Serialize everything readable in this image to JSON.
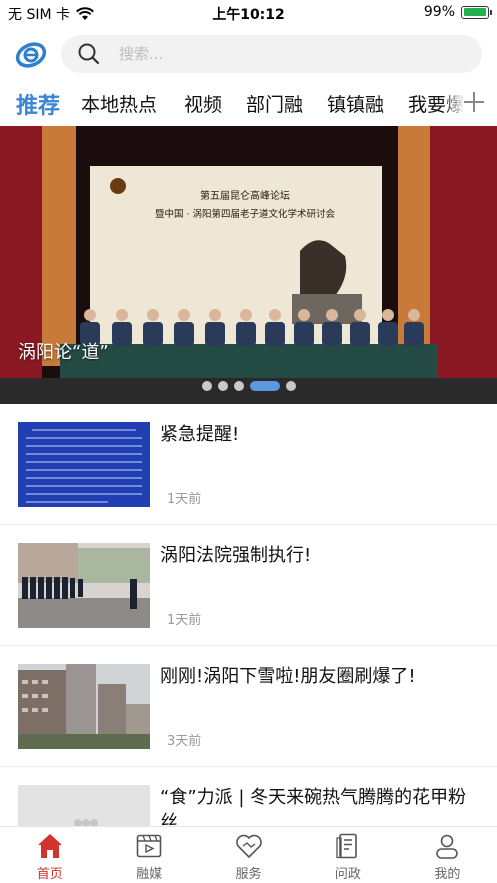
{
  "status_bar": {
    "carrier": "无 SIM 卡",
    "time": "上午10:12",
    "battery": "99%",
    "battery_level": 0.99
  },
  "header": {
    "logo_icon": "app-logo-icon",
    "search_placeholder": "搜索..."
  },
  "tabs": [
    {
      "label": "推荐",
      "active": true
    },
    {
      "label": "本地热点",
      "active": false
    },
    {
      "label": "视频",
      "active": false
    },
    {
      "label": "部门融",
      "active": false
    },
    {
      "label": "镇镇融",
      "active": false
    },
    {
      "label": "我要爆",
      "active": false
    }
  ],
  "banner": {
    "caption": "涡阳论“道”",
    "slide_count": 5,
    "active_slide": 4,
    "screen_text_line1": "第五届昆仑高峰论坛",
    "screen_text_line2": "暨中国 · 涡阳第四届老子道文化学术研讨会"
  },
  "news": [
    {
      "title": "紧急提醒!",
      "time": "1天前"
    },
    {
      "title": "涡阳法院强制执行!",
      "time": "1天前"
    },
    {
      "title": "刚刚!涡阳下雪啦!朋友圈刷爆了!",
      "time": "3天前"
    },
    {
      "title": "“食”力派 | 冬天来碗热气腾腾的花甲粉丝",
      "time": ""
    }
  ],
  "bottom_nav": [
    {
      "label": "首页",
      "icon": "home-icon",
      "active": true
    },
    {
      "label": "融媒",
      "icon": "media-icon",
      "active": false
    },
    {
      "label": "服务",
      "icon": "service-icon",
      "active": false
    },
    {
      "label": "问政",
      "icon": "document-icon",
      "active": false
    },
    {
      "label": "我的",
      "icon": "profile-icon",
      "active": false
    }
  ],
  "colors": {
    "accent_blue": "#3a86d4",
    "active_red": "#d0342c",
    "battery_green": "#22b14c"
  }
}
